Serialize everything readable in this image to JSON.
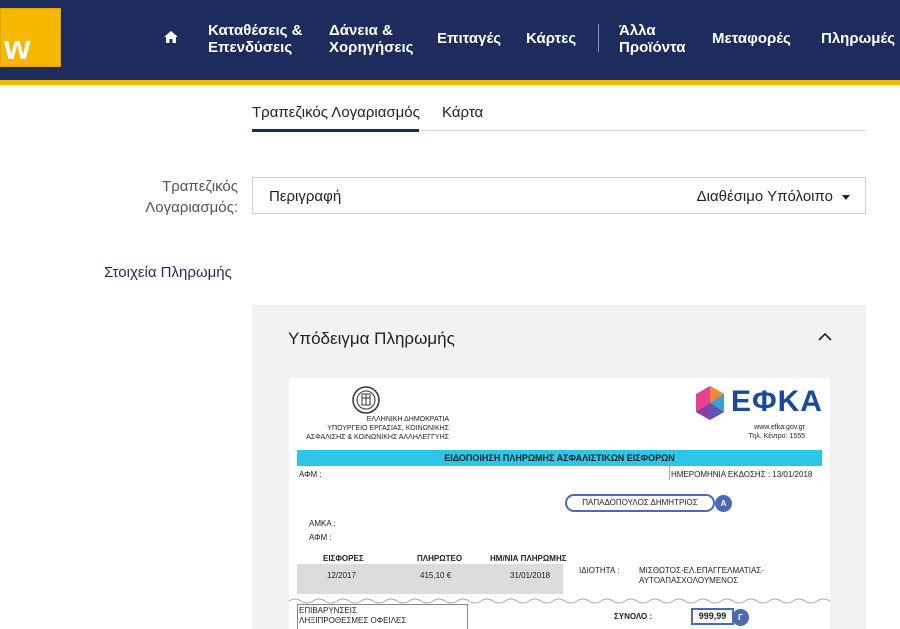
{
  "brand": {
    "logo_text": "w",
    "accent": "#f5b800",
    "nav_bg": "#1d2c5c"
  },
  "nav": {
    "home_icon": "home-icon",
    "items": [
      {
        "line1": "Καταθέσεις &",
        "line2": "Επενδύσεις"
      },
      {
        "line1": "Δάνεια &",
        "line2": "Χορηγήσεις"
      },
      {
        "line1": "Επιταγές",
        "line2": ""
      },
      {
        "line1": "Κάρτες",
        "line2": ""
      },
      {
        "line1": "Άλλα",
        "line2": "Προϊόντα"
      },
      {
        "line1": "Μεταφορές",
        "line2": ""
      },
      {
        "line1": "Πληρωμές",
        "line2": ""
      }
    ]
  },
  "tabs": [
    {
      "label": "Τραπεζικός Λογαριασμός",
      "active": true
    },
    {
      "label": "Κάρτα",
      "active": false
    }
  ],
  "account": {
    "label_line1": "Τραπεζικός",
    "label_line2": "Λογαριασμός:",
    "description": "Περιγραφή",
    "balance": "Διαθέσιμο Υπόλοιπο"
  },
  "payment_section_title": "Στοιχεία Πληρωμής",
  "sample": {
    "title": "Υπόδειγμα Πληρωμής",
    "doc": {
      "ministry_line1": "ΕΛΛΗΝΙΚΗ ΔΗΜΟΚΡΑΤΙΑ",
      "ministry_line2": "ΥΠΟΥΡΓΕΙΟ ΕΡΓΑΣΙΑΣ, ΚΟΙΝΩΝΙΚΗΣ",
      "ministry_line3": "ΑΣΦΑΛΙΣΗΣ & ΚΟΙΝΩΝΙΚΗΣ ΑΛΛΗΛΕΓΓΥΗΣ",
      "efka": "ΕΦΚΑ",
      "website": "www.efka.gov.gr",
      "phone": "Τηλ. Κέντρο: 1555",
      "banner": "ΕΙΔΟΠΟΙΗΣΗ ΠΛΗΡΩΜΗΣ ΑΣΦΑΛΙΣΤΙΚΩΝ ΕΙΣΦΟΡΩΝ",
      "afm_top": "ΑΦΜ :",
      "issue_date": "ΗΜΕΡΟΜΗΝΙΑ ΕΚΔΟΣΗΣ : 13/01/2018",
      "name": "ΠΑΠΑΔΟΠΟΥΛΟΣ ΔΗΜΗΤΡΙΟΣ",
      "badge_a": "Α",
      "amka": "ΑΜΚΑ :",
      "afm": "ΑΦΜ :",
      "col_contrib": "ΕΙΣΦΟΡΕΣ",
      "col_payable": "ΠΛΗΡΩΤΕΟ",
      "col_date": "ΗΜ/ΝΙΑ ΠΛΗΡΩΜΗΣ",
      "val_contrib": "12/2017",
      "val_payable": "415,10 €",
      "val_date": "31/01/2018",
      "capacity_label": "ΙΔΙΟΤΗΤΑ :",
      "capacity_line1": "ΜΙΣΘΩΤΟΣ-ΕΛ.ΕΠΑΓΓΕΛΜΑΤΙΑΣ-",
      "capacity_line2": "ΑΥΤΟΑΠΑΣΧΟΛΟΥΜΕΝΟΣ",
      "fees_line1": "ΕΠΙΒΑΡΥΝΣΕΙΣ",
      "fees_line2": "ΛΗΞΙΠΡΟΘΕΣΜΕΣ ΟΦΕΙΛΕΣ",
      "total_label": "ΣΥΝΟΛΟ :",
      "total_value": "999,99",
      "badge_g": "Γ"
    }
  }
}
